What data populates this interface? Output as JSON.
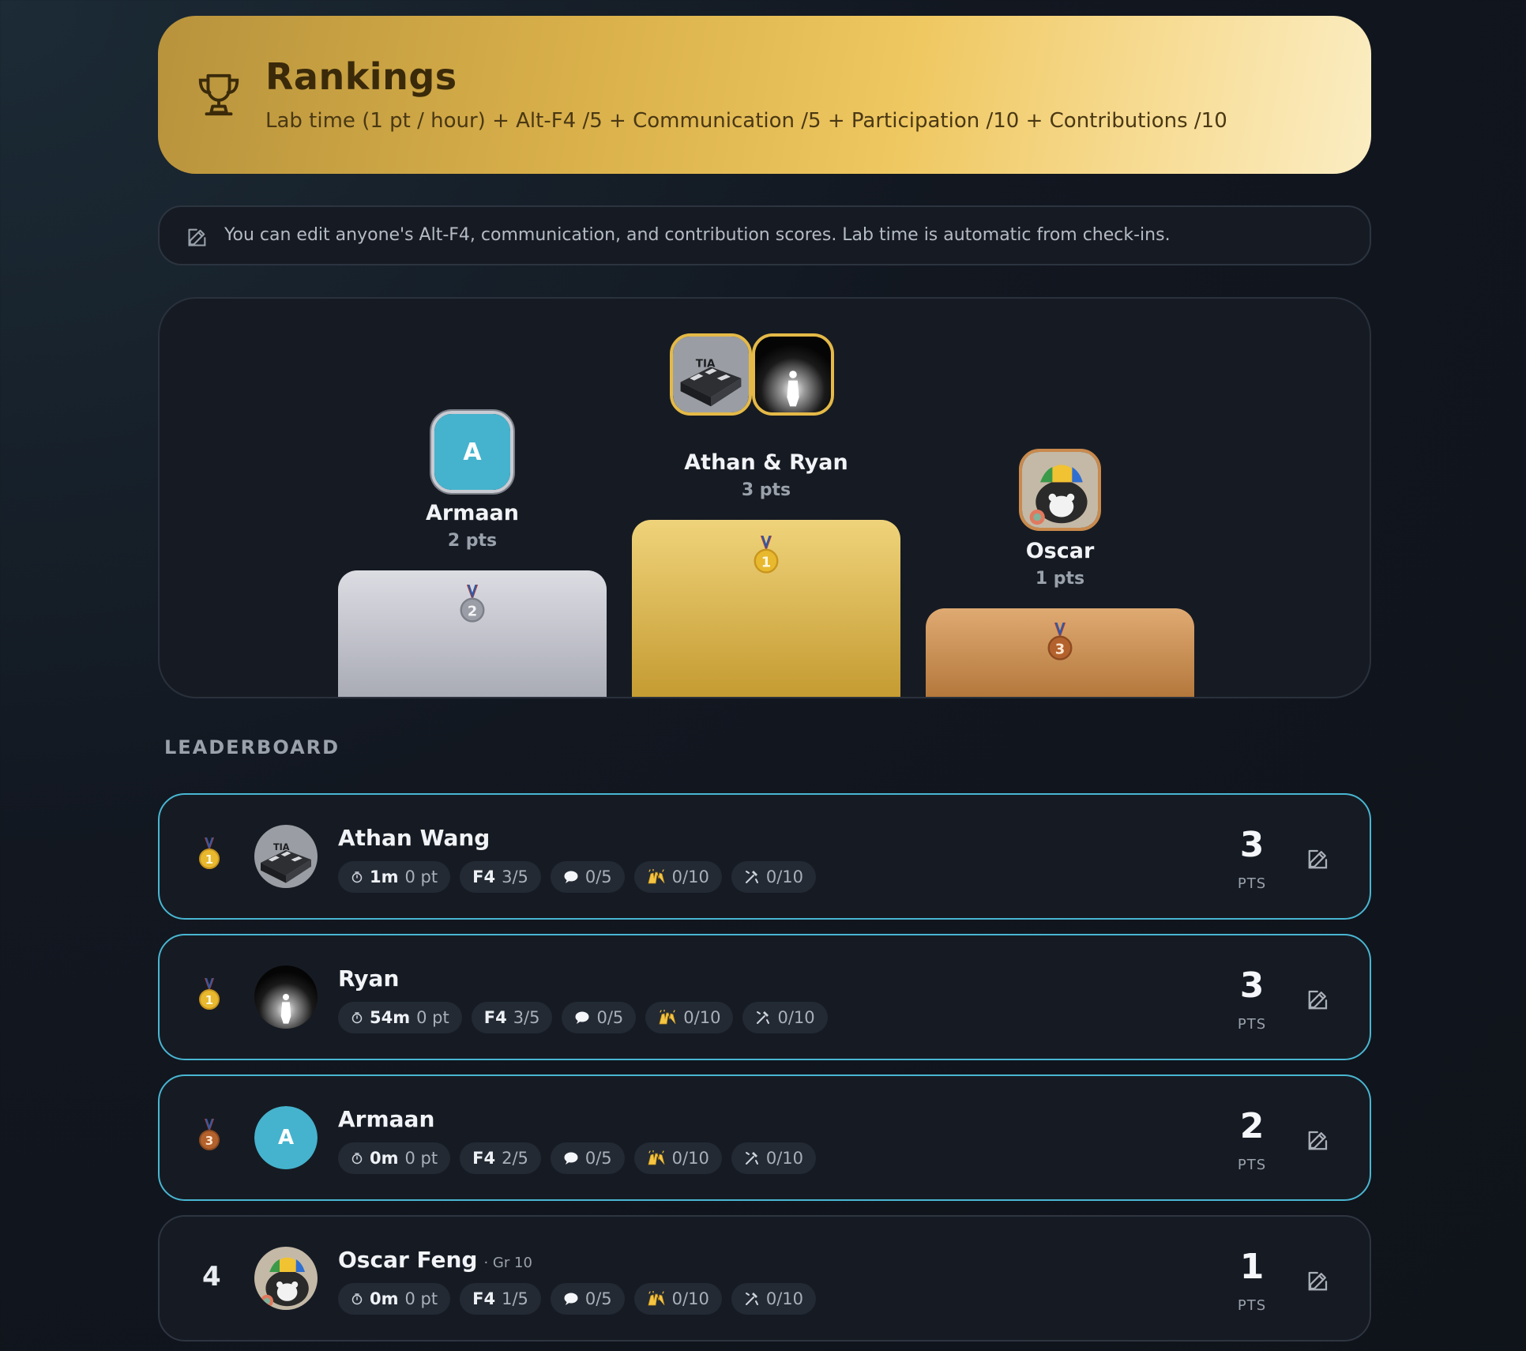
{
  "header": {
    "title": "Rankings",
    "subtitle": "Lab time (1 pt / hour) + Alt-F4 /5 + Communication /5 + Participation /10 + Contributions /10",
    "icon": "trophy-icon"
  },
  "note": {
    "text": "You can edit anyone's Alt-F4, communication, and contribution scores. Lab time is automatic from check-ins.",
    "icon": "pencil-icon"
  },
  "podium": {
    "first": {
      "name": "Athan & Ryan",
      "points": "3 pts",
      "medal": "1"
    },
    "second": {
      "name": "Armaan",
      "points": "2 pts",
      "medal": "2",
      "avatar_letter": "A"
    },
    "third": {
      "name": "Oscar",
      "points": "1 pts",
      "medal": "3"
    }
  },
  "leaderboard": {
    "title": "LEADERBOARD",
    "rows": [
      {
        "rank": "1",
        "rank_style": "gold-medal",
        "name": "Athan Wang",
        "time": "1m",
        "time_pts": "0 pt",
        "f4_label": "F4",
        "f4": "3/5",
        "comm": "0/5",
        "part": "0/10",
        "contrib": "0/10",
        "score": "3",
        "score_label": "PTS"
      },
      {
        "rank": "1",
        "rank_style": "gold-medal",
        "name": "Ryan",
        "time": "54m",
        "time_pts": "0 pt",
        "f4_label": "F4",
        "f4": "3/5",
        "comm": "0/5",
        "part": "0/10",
        "contrib": "0/10",
        "score": "3",
        "score_label": "PTS"
      },
      {
        "rank": "3",
        "rank_style": "bronze-medal",
        "name": "Armaan",
        "avatar_letter": "A",
        "time": "0m",
        "time_pts": "0 pt",
        "f4_label": "F4",
        "f4": "2/5",
        "comm": "0/5",
        "part": "0/10",
        "contrib": "0/10",
        "score": "2",
        "score_label": "PTS"
      },
      {
        "rank": "4",
        "rank_style": "number",
        "name": "Oscar Feng",
        "grade": "· Gr 10",
        "time": "0m",
        "time_pts": "0 pt",
        "f4_label": "F4",
        "f4": "1/5",
        "comm": "0/5",
        "part": "0/10",
        "contrib": "0/10",
        "score": "1",
        "score_label": "PTS"
      }
    ]
  },
  "colors": {
    "accent_border": "#49b6d2",
    "gold": "#e4b947",
    "silver": "#c9cbd3",
    "bronze": "#c98a4d",
    "avatar_teal": "#45b3cd"
  }
}
